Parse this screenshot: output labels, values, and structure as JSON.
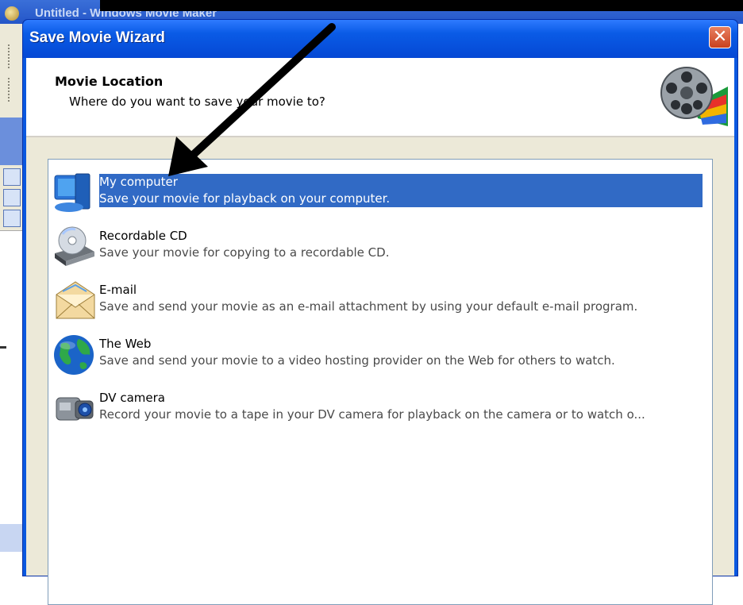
{
  "background_window": {
    "title": "Untitled - Windows Movie Maker"
  },
  "dialog": {
    "title": "Save Movie Wizard",
    "close_label": "✕",
    "header": {
      "title": "Movie Location",
      "subtitle": "Where do you want to save your movie to?"
    },
    "options": [
      {
        "title": "My computer",
        "description": "Save your movie for playback on your computer.",
        "icon": "computer-icon",
        "selected": true
      },
      {
        "title": "Recordable CD",
        "description": "Save your movie for copying to a recordable CD.",
        "icon": "cd-drive-icon",
        "selected": false
      },
      {
        "title": "E-mail",
        "description": "Save and send your movie as an e-mail attachment by using your default e-mail program.",
        "icon": "envelope-icon",
        "selected": false
      },
      {
        "title": "The Web",
        "description": "Save and send your movie to a video hosting provider on the Web for others to watch.",
        "icon": "globe-icon",
        "selected": false
      },
      {
        "title": "DV camera",
        "description": "Record your movie to a tape in your DV camera for playback on the camera or to watch o...",
        "icon": "camcorder-icon",
        "selected": false
      }
    ]
  },
  "colors": {
    "selection": "#316ac5",
    "title_bar": "#0a5be6",
    "dialog_face": "#ece9d8"
  }
}
